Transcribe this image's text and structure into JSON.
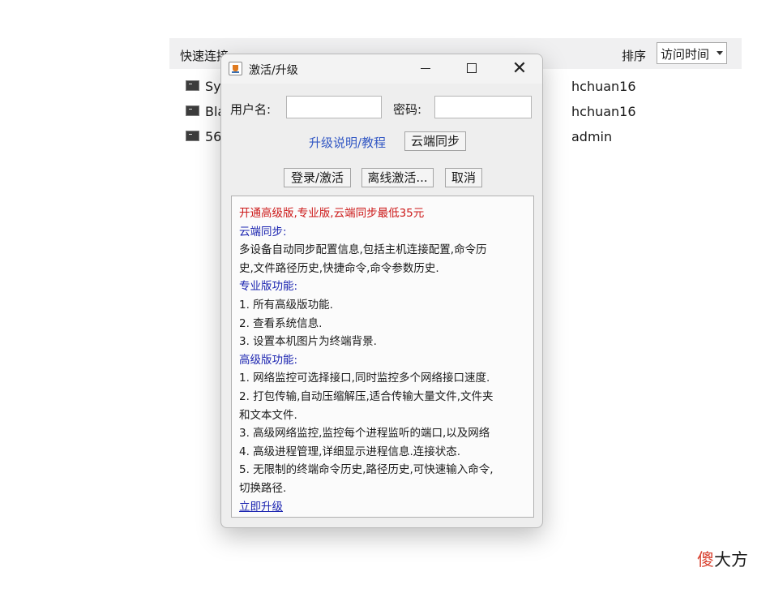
{
  "background": {
    "header_title": "快速连接",
    "sort_label": "排序",
    "sort_value": "访问时间",
    "connections": [
      {
        "name": "Sy",
        "user": "hchuan16"
      },
      {
        "name": "Bla",
        "user": "hchuan16"
      },
      {
        "name": "56",
        "user": "admin"
      }
    ]
  },
  "dialog": {
    "title": "激活/升级",
    "username_label": "用户名:",
    "username_value": "",
    "password_label": "密码:",
    "password_value": "",
    "upgrade_link": "升级说明/教程",
    "cloud_sync_button": "云端同步",
    "login_button": "登录/激活",
    "offline_button": "离线激活...",
    "cancel_button": "取消",
    "info": {
      "promo": "开通高级版,专业版,云端同步最低35元",
      "cloud_title": "云端同步:",
      "cloud_line1": "多设备自动同步配置信息,包括主机连接配置,命令历",
      "cloud_line2": "史,文件路径历史,快捷命令,命令参数历史.",
      "pro_title": "专业版功能:",
      "pro_items": [
        "1. 所有高级版功能.",
        "2. 查看系统信息.",
        "3. 设置本机图片为终端背景."
      ],
      "adv_title": "高级版功能:",
      "adv_items": [
        "1. 网络监控可选择接口,同时监控多个网络接口速度.",
        "2. 打包传输,自动压缩解压,适合传输大量文件,文件夹",
        "和文本文件.",
        "3. 高级网络监控,监控每个进程监听的端口,以及网络",
        "4. 高级进程管理,详细显示进程信息.连接状态.",
        "5. 无限制的终端命令历史,路径历史,可快速输入命令,",
        "切换路径."
      ],
      "upgrade_now": "立即升级"
    }
  },
  "watermark": {
    "first": "傻",
    "rest": "大方"
  },
  "colors": {
    "promo": "#cc1818",
    "heading": "#1b24b0",
    "link": "#3358c4"
  }
}
